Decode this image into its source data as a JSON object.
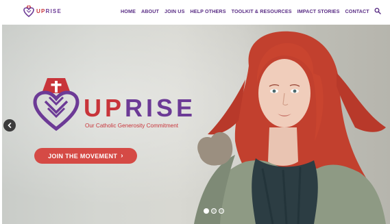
{
  "header": {
    "logo": {
      "up": "UP",
      "rise": "RISE"
    },
    "nav": [
      {
        "label": "HOME"
      },
      {
        "label": "ABOUT"
      },
      {
        "label": "JOIN US"
      },
      {
        "label": "HELP OTHERS"
      },
      {
        "label": "TOOLKIT & RESOURCES"
      },
      {
        "label": "IMPACT STORIES"
      },
      {
        "label": "CONTACT"
      }
    ],
    "search_icon": "search-icon"
  },
  "hero": {
    "brand": {
      "up": "UP",
      "rise": "RISE",
      "tagline": "Our Catholic Generosity Commitment"
    },
    "cta": {
      "label": "JOIN THE MOVEMENT",
      "chevron": "›"
    },
    "carousel": {
      "slides": 3,
      "active_index": 0
    }
  },
  "colors": {
    "brand_red": "#c8343a",
    "brand_purple": "#6c3a96",
    "nav_text": "#5b2f86",
    "cta_bg": "#d54a45"
  }
}
